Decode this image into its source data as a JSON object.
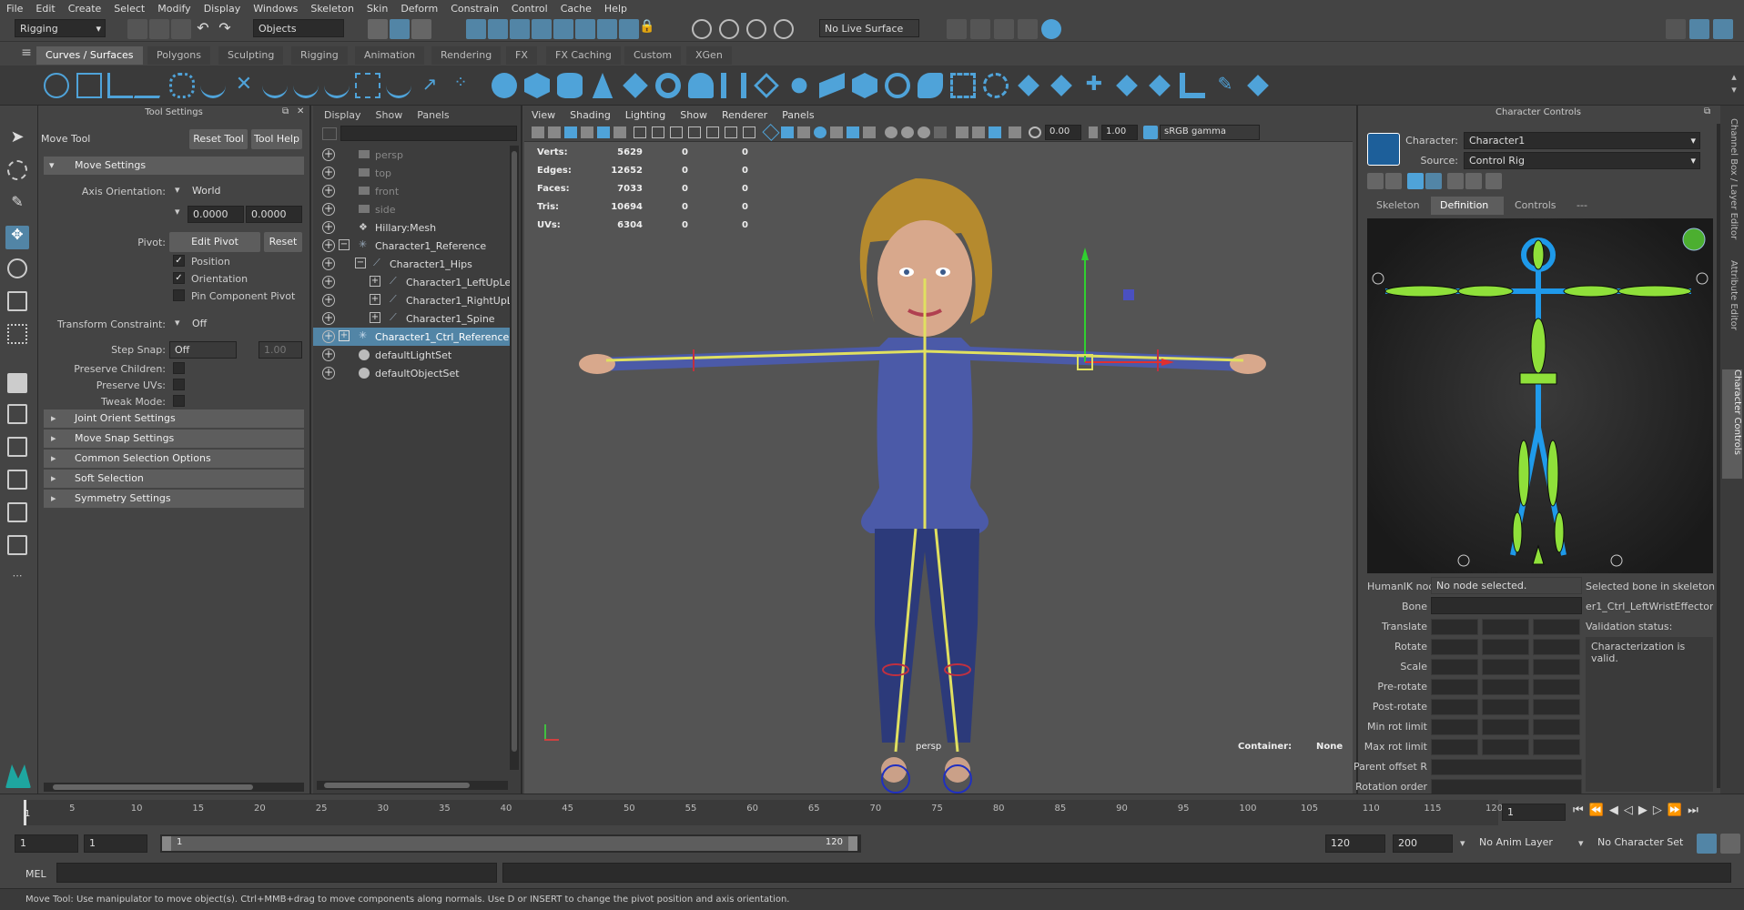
{
  "menu": [
    "File",
    "Edit",
    "Create",
    "Select",
    "Modify",
    "Display",
    "Windows",
    "Skeleton",
    "Skin",
    "Deform",
    "Constrain",
    "Control",
    "Cache",
    "Help"
  ],
  "status": {
    "mode": "Rigging",
    "selection_mask": "Objects",
    "live_surface": "No Live Surface"
  },
  "shelf_tabs": [
    "Curves / Surfaces",
    "Polygons",
    "Sculpting",
    "Rigging",
    "Animation",
    "Rendering",
    "FX",
    "FX Caching",
    "Custom",
    "XGen"
  ],
  "tool_settings": {
    "panel_title": "Tool Settings",
    "tool_name": "Move Tool",
    "reset_tool": "Reset Tool",
    "tool_help": "Tool Help",
    "move_settings": "Move Settings",
    "axis_orientation_label": "Axis Orientation:",
    "axis_orientation": "World",
    "axis_x": "0.0000",
    "axis_y": "0.0000",
    "pivot_label": "Pivot:",
    "edit_pivot": "Edit Pivot",
    "reset": "Reset",
    "position": "Position",
    "orientation": "Orientation",
    "pin_component_pivot": "Pin Component Pivot",
    "transform_constraint_label": "Transform Constraint:",
    "transform_constraint": "Off",
    "step_snap_label": "Step Snap:",
    "step_snap": "Off",
    "step_snap_value": "1.00",
    "preserve_children": "Preserve Children:",
    "preserve_uvs": "Preserve UVs:",
    "tweak_mode": "Tweak Mode:",
    "sections": [
      "Joint Orient Settings",
      "Move Snap Settings",
      "Common Selection Options",
      "Soft Selection",
      "Symmetry Settings"
    ]
  },
  "outliner": {
    "menu": [
      "Display",
      "Show",
      "Panels"
    ],
    "items": [
      {
        "name": "persp",
        "dim": true
      },
      {
        "name": "top",
        "dim": true
      },
      {
        "name": "front",
        "dim": true
      },
      {
        "name": "side",
        "dim": true
      },
      {
        "name": "Hillary:Mesh",
        "dim": false
      },
      {
        "name": "Character1_Reference",
        "dim": false
      },
      {
        "name": "Character1_Hips",
        "dim": false
      },
      {
        "name": "Character1_LeftUpLe",
        "dim": false
      },
      {
        "name": "Character1_RightUpL",
        "dim": false
      },
      {
        "name": "Character1_Spine",
        "dim": false
      },
      {
        "name": "Character1_Ctrl_Reference",
        "dim": false
      },
      {
        "name": "defaultLightSet",
        "dim": false
      },
      {
        "name": "defaultObjectSet",
        "dim": false
      }
    ]
  },
  "viewport": {
    "menu": [
      "View",
      "Shading",
      "Lighting",
      "Show",
      "Renderer",
      "Panels"
    ],
    "exposure": "0.00",
    "gamma": "1.00",
    "color_space": "sRGB gamma",
    "hud": [
      {
        "label": "Verts:",
        "a": "5629",
        "b": "0",
        "c": "0"
      },
      {
        "label": "Edges:",
        "a": "12652",
        "b": "0",
        "c": "0"
      },
      {
        "label": "Faces:",
        "a": "7033",
        "b": "0",
        "c": "0"
      },
      {
        "label": "Tris:",
        "a": "10694",
        "b": "0",
        "c": "0"
      },
      {
        "label": "UVs:",
        "a": "6304",
        "b": "0",
        "c": "0"
      }
    ],
    "camera": "persp",
    "container_label": "Container:",
    "container": "None"
  },
  "character_controls": {
    "title": "Character Controls",
    "character_label": "Character:",
    "character": "Character1",
    "source_label": "Source:",
    "source": "Control Rig",
    "tabs": [
      "Skeleton",
      "Definition",
      "Controls",
      "---"
    ],
    "humanik_label": "HumanIK node",
    "humanik_value": "No node selected.",
    "selected_bone_label": "Selected bone in skeleton",
    "bone_label": "Bone",
    "bone_value": "er1_Ctrl_LeftWristEffector",
    "validation_label": "Validation status:",
    "validation_value": "Characterization is valid.",
    "props": [
      "Translate",
      "Rotate",
      "Scale",
      "Pre-rotate",
      "Post-rotate",
      "Min rot limit",
      "Max rot limit",
      "Parent offset R",
      "Rotation order"
    ]
  },
  "side_tabs": [
    "Channel Box / Layer Editor",
    "Attribute Editor",
    "Character Controls"
  ],
  "timeline": {
    "ticks": [
      "5",
      "10",
      "15",
      "20",
      "25",
      "30",
      "35",
      "40",
      "45",
      "50",
      "55",
      "60",
      "65",
      "70",
      "75",
      "80",
      "85",
      "90",
      "95",
      "100",
      "105",
      "110",
      "115",
      "120"
    ],
    "current_frame": "1",
    "start_marker": "1"
  },
  "range": {
    "start": "1",
    "playback_start": "1",
    "slider_start": "1",
    "slider_end": "120",
    "playback_end": "120",
    "end": "200",
    "anim_layer": "No Anim Layer",
    "character_set": "No Character Set"
  },
  "cmd": {
    "label": "MEL"
  },
  "help_line": "Move Tool: Use manipulator to move object(s). Ctrl+MMB+drag to move components along normals. Use D or INSERT to change the pivot position and axis orientation.",
  "colors": {
    "accent": "#5285a6",
    "icon_blue": "#4fa3d9",
    "joint": "#e0e060",
    "suit": "#2c3a7a",
    "hik_green": "#8fe03a",
    "hik_outline": "#1ea6ff"
  }
}
